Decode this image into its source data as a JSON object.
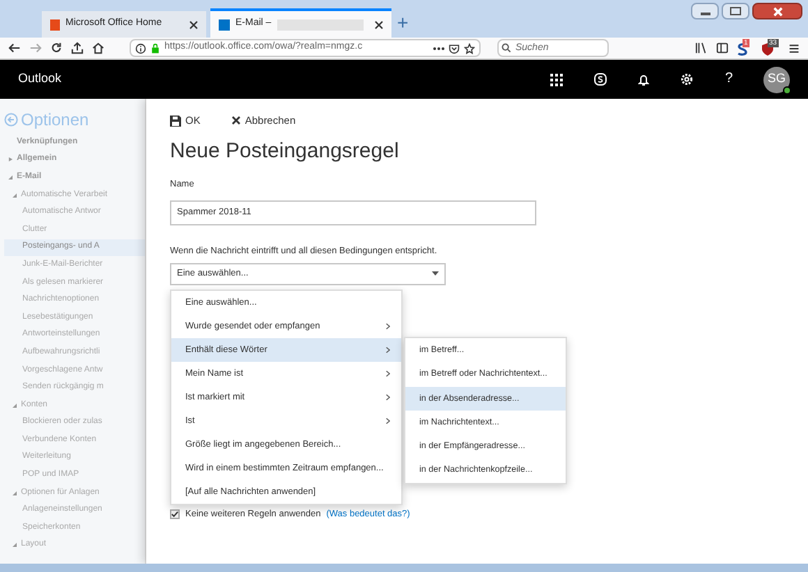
{
  "browser": {
    "tabs": [
      {
        "label": "Microsoft Office Home",
        "selected": false
      },
      {
        "label": "E-Mail –",
        "selected": true
      }
    ],
    "new_tab": "+",
    "address": "https://outlook.office.com/owa/?realm=nmgz.c",
    "search": {
      "placeholder": "Suchen"
    },
    "badges": [
      "1",
      "33"
    ]
  },
  "app_bar": {
    "title": "Outlook",
    "help": "?",
    "avatar": "SG"
  },
  "sidebar": {
    "back": "Optionen",
    "items": [
      {
        "label": "Verknüpfungen",
        "selected": false
      },
      {
        "label": "Allgemein",
        "selected": false,
        "expanded": false
      },
      {
        "label": "E-Mail",
        "selected": false,
        "expanded": true,
        "children": [
          {
            "label": "Automatische Verarbeit",
            "selected": false,
            "expanded": true,
            "children": [
              {
                "label": "Automatische Antwor",
                "selected": false
              },
              {
                "label": "Clutter",
                "selected": false
              },
              {
                "label": "Posteingangs- und A",
                "selected": true
              },
              {
                "label": "Junk-E-Mail-Berichter",
                "selected": false
              },
              {
                "label": "Als gelesen markierer",
                "selected": false
              },
              {
                "label": "Nachrichtenoptionen",
                "selected": false
              },
              {
                "label": "Lesebestätigungen",
                "selected": false
              },
              {
                "label": "Antworteinstellungen",
                "selected": false
              },
              {
                "label": "Aufbewahrungsrichtli",
                "selected": false
              },
              {
                "label": "Vorgeschlagene Antw",
                "selected": false
              },
              {
                "label": "Senden rückgängig m",
                "selected": false
              }
            ]
          },
          {
            "label": "Konten",
            "selected": false,
            "expanded": true,
            "children": [
              {
                "label": "Blockieren oder zulas",
                "selected": false
              },
              {
                "label": "Verbundene Konten",
                "selected": false
              },
              {
                "label": "Weiterleitung",
                "selected": false
              },
              {
                "label": "POP und IMAP",
                "selected": false
              }
            ]
          },
          {
            "label": "Optionen für Anlagen",
            "selected": false,
            "expanded": true,
            "children": [
              {
                "label": "Anlageneinstellungen",
                "selected": false
              },
              {
                "label": "Speicherkonten",
                "selected": false
              }
            ]
          },
          {
            "label": "Layout",
            "selected": false,
            "expanded": true
          }
        ]
      }
    ]
  },
  "toolbar": {
    "ok": "OK",
    "cancel": "Abbrechen"
  },
  "heading": "Neue Posteingangsregel",
  "name_field": {
    "label": "Name",
    "value": "Spammer 2018-11"
  },
  "condition": {
    "label": "Wenn die Nachricht eintrifft und all diesen Bedingungen entspricht.",
    "value": "Eine auswählen..."
  },
  "menu": [
    {
      "label": "Eine auswählen...",
      "submenu": false,
      "selected": false
    },
    {
      "label": "Wurde gesendet oder empfangen",
      "submenu": true,
      "selected": false
    },
    {
      "label": "Enthält diese Wörter",
      "submenu": true,
      "selected": true
    },
    {
      "label": "Mein Name ist",
      "submenu": true,
      "selected": false
    },
    {
      "label": "Ist markiert mit",
      "submenu": true,
      "selected": false
    },
    {
      "label": "Ist",
      "submenu": true,
      "selected": false
    },
    {
      "label": "Größe liegt im angegebenen Bereich...",
      "submenu": false,
      "selected": false
    },
    {
      "label": "Wird in einem bestimmten Zeitraum empfangen...",
      "submenu": false,
      "selected": false
    },
    {
      "label": "[Auf alle Nachrichten anwenden]",
      "submenu": false,
      "selected": false
    }
  ],
  "submenu": [
    {
      "label": "im Betreff...",
      "selected": false
    },
    {
      "label": "im Betreff oder Nachrichtentext...",
      "selected": false
    },
    {
      "label": "in der Absenderadresse...",
      "selected": true
    },
    {
      "label": "im Nachrichtentext...",
      "selected": false
    },
    {
      "label": "in der Empfängeradresse...",
      "selected": false
    },
    {
      "label": "in der Nachrichtenkopfzeile...",
      "selected": false
    }
  ],
  "stop_rule": {
    "label": "Keine weiteren Regeln anwenden",
    "checked": true,
    "link": "(Was bedeutet das?)"
  }
}
